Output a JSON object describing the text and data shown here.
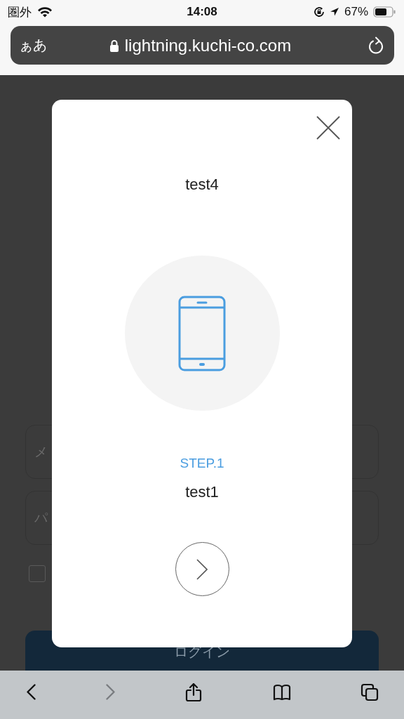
{
  "status_bar": {
    "carrier": "圏外",
    "time": "14:08",
    "battery": "67%"
  },
  "address_bar": {
    "text_size_button": "ぁあ",
    "url": "lightning.kuchi-co.com"
  },
  "background_form": {
    "fields": [
      {
        "placeholder": "メ"
      },
      {
        "placeholder": "パ"
      }
    ],
    "remember_checkbox": {
      "checked": false
    },
    "login_button": "ログイン"
  },
  "modal": {
    "title": "test4",
    "step_label": "STEP.1",
    "step_title": "test1"
  },
  "toolbar": {
    "buttons": [
      {
        "kind": "back",
        "disabled": false
      },
      {
        "kind": "forward",
        "disabled": true
      },
      {
        "kind": "share",
        "disabled": false
      },
      {
        "kind": "bookmarks",
        "disabled": false
      },
      {
        "kind": "tabs",
        "disabled": false
      }
    ]
  }
}
